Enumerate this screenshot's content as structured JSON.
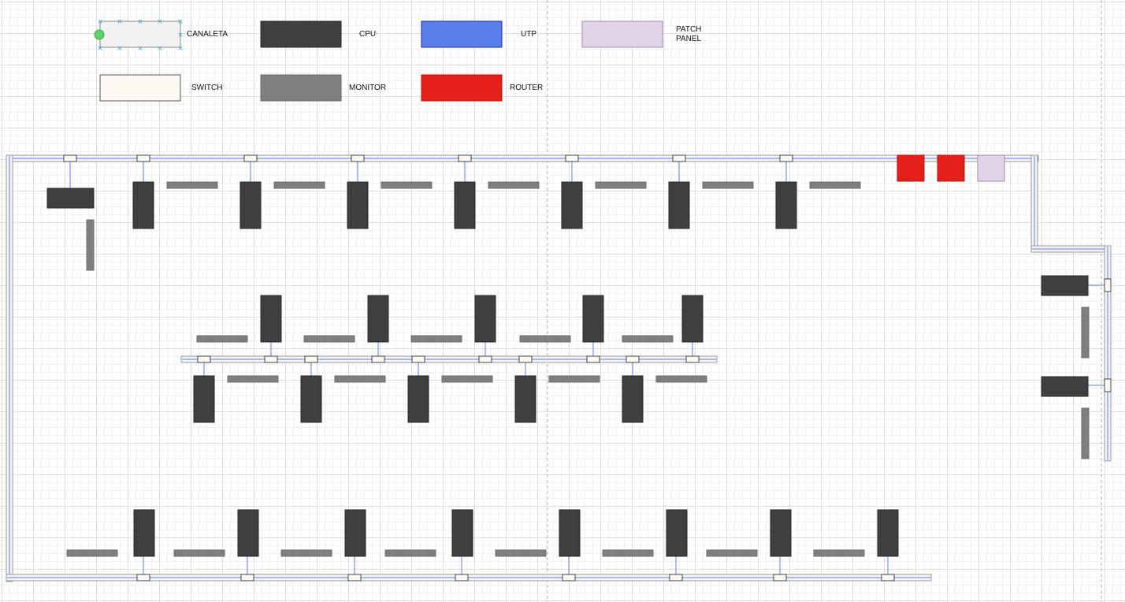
{
  "legend": [
    {
      "id": "canaleta",
      "label": "CANALETA",
      "fill": "#f2f2f2",
      "stroke": "#888888"
    },
    {
      "id": "cpu",
      "label": "CPU",
      "fill": "#3f3f3f",
      "stroke": "#2a2a2a"
    },
    {
      "id": "utp",
      "label": "UTP",
      "fill": "#5b7fea",
      "stroke": "#1a2aa8"
    },
    {
      "id": "patch-panel",
      "label": "PATCH\nPANEL",
      "fill": "#e2d4e7",
      "stroke": "#a48ab0"
    },
    {
      "id": "switch",
      "label": "SWITCH",
      "fill": "#fbf8f2",
      "stroke": "#555555"
    },
    {
      "id": "monitor",
      "label": "MONITOR",
      "fill": "#7f7f7f",
      "stroke": "#6a6a6a"
    },
    {
      "id": "router",
      "label": "ROUTER",
      "fill": "#e5201a",
      "stroke": "#b81510"
    }
  ],
  "colors": {
    "cpu": "#3f3f3f",
    "monitor": "#7f7f7f",
    "router": "#e5201a",
    "patch_panel": "#e2d4e7",
    "utp": "#5b7fea",
    "canaleta_fill": "#f4f4f4",
    "canaleta_stroke": "#9a9a9a",
    "outlet": "#fbf8f2",
    "selection": "#3da6e0",
    "selection_dot": "#5ed36a"
  },
  "equipment_counts": {
    "top_row_workstations": 8,
    "middle_upper_workstations": 5,
    "middle_lower_workstations": 5,
    "bottom_row_workstations": 8,
    "right_wall_workstations": 2,
    "routers": 2,
    "patch_panels": 1
  }
}
